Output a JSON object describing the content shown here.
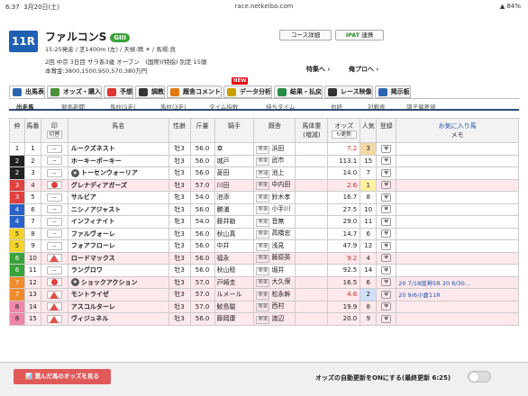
{
  "status_bar": {
    "time": "6:37",
    "date": "3月20日(土)",
    "url": "race.netkeiba.com",
    "battery": "84%"
  },
  "race": {
    "number": "11R",
    "name": "ファルコンS",
    "grade": "GIII",
    "info_line1": "15:25発走 / 芝1400m (左) / 天候:晴 ☀ / 馬場:良",
    "info_line2": "2回 中京 3日目 サラ系3歳 オープン　(国際)(特指) 別定 15頭",
    "info_line3": "本賞金:3800,1500,950,570,380万円"
  },
  "buttons": {
    "course": "コース詳細",
    "ipat_logo": "IPAT",
    "ipat_label": "連携"
  },
  "links": {
    "special": "特集へ ›",
    "my_pro": "俺プロへ ›"
  },
  "tabs": [
    {
      "label": "出馬表",
      "color": "#2a63b0",
      "active": true,
      "new": false
    },
    {
      "label": "オッズ・購入",
      "color": "#4a8f3a",
      "active": false,
      "new": false
    },
    {
      "label": "予想",
      "color": "#d33",
      "active": false,
      "new": false
    },
    {
      "label": "調教",
      "color": "#333",
      "active": false,
      "new": false
    },
    {
      "label": "厩舎コメント",
      "color": "#e07a10",
      "active": false,
      "new": false
    },
    {
      "label": "データ分析",
      "color": "#c8a000",
      "active": false,
      "new": true
    },
    {
      "label": "結果・払戻",
      "color": "#2a8a4a",
      "active": false,
      "new": false
    },
    {
      "label": "レース映像",
      "color": "#333",
      "active": false,
      "new": false
    },
    {
      "label": "掲示板",
      "color": "#2a63b0",
      "active": false,
      "new": false
    }
  ],
  "new_label": "NEW",
  "subtabs": [
    {
      "label": "出走馬",
      "active": true
    },
    {
      "label": "競馬新聞",
      "active": false
    },
    {
      "label": "馬柱(5走)",
      "active": false
    },
    {
      "label": "馬柱(3走)",
      "active": false
    },
    {
      "label": "タイム指数",
      "active": false
    },
    {
      "label": "持ちタイム",
      "active": false
    },
    {
      "label": "血統",
      "active": false
    },
    {
      "label": "対戦表",
      "active": false
    },
    {
      "label": "調子偏差値",
      "active": false
    }
  ],
  "table": {
    "headers": {
      "waku": "枠",
      "umaban": "馬番",
      "mark": "印",
      "mark_sub": "切替",
      "name": "馬名",
      "sex_age": "性齢",
      "weight": "斤量",
      "jockey": "騎手",
      "trainer": "厩舎",
      "body_weight": "馬体重",
      "body_weight_sub": "(増減)",
      "odds": "オッズ",
      "odds_sub": "更新",
      "pop": "人気",
      "reg": "登録",
      "fav": "お気に入り馬",
      "memo": "メモ"
    },
    "rows": [
      {
        "waku": "1",
        "wcolor": "#ffffff",
        "wtext": "#222",
        "num": "1",
        "mark": "--",
        "mclass": "",
        "icon": "",
        "name": "ルークズネスト",
        "sa": "牡3",
        "kin": "56.0",
        "jockey": "幸",
        "tt": "栗東",
        "trainer": "浜田",
        "odds": "7.2",
        "oclass": "red",
        "pop": "3",
        "pbg": "#f5d9a8",
        "hi": false,
        "memo": ""
      },
      {
        "waku": "2",
        "wcolor": "#222222",
        "wtext": "#fff",
        "num": "2",
        "mark": "--",
        "mclass": "",
        "icon": "",
        "name": "ホーキーポーキー",
        "sa": "牡3",
        "kin": "56.0",
        "jockey": "城戸",
        "tt": "栗東",
        "trainer": "武市",
        "odds": "113.1",
        "oclass": "",
        "pop": "15",
        "pbg": "",
        "hi": false,
        "memo": ""
      },
      {
        "waku": "2",
        "wcolor": "#222222",
        "wtext": "#fff",
        "num": "3",
        "mark": "--",
        "mclass": "",
        "icon": "circle-dark",
        "name": "トーセンウォーリア",
        "sa": "牡3",
        "kin": "56.0",
        "jockey": "菱田",
        "tt": "美浦",
        "trainer": "池上",
        "odds": "14.0",
        "oclass": "",
        "pop": "7",
        "pbg": "",
        "hi": false,
        "memo": ""
      },
      {
        "waku": "3",
        "wcolor": "#e04040",
        "wtext": "#fff",
        "num": "4",
        "mark": "",
        "mclass": "red",
        "icon": "",
        "name": "グレナディアガーズ",
        "sa": "牡3",
        "kin": "57.0",
        "jockey": "川田",
        "tt": "栗東",
        "trainer": "中内田",
        "odds": "2.6",
        "oclass": "red",
        "pop": "1",
        "pbg": "#fff1a0",
        "hi": true,
        "memo": ""
      },
      {
        "waku": "3",
        "wcolor": "#e04040",
        "wtext": "#fff",
        "num": "5",
        "mark": "--",
        "mclass": "",
        "icon": "",
        "name": "サルビア",
        "sa": "牝3",
        "kin": "54.0",
        "jockey": "池添",
        "tt": "栗東",
        "trainer": "鈴木孝",
        "odds": "16.7",
        "oclass": "",
        "pop": "8",
        "pbg": "",
        "hi": false,
        "memo": ""
      },
      {
        "waku": "4",
        "wcolor": "#2a63c8",
        "wtext": "#fff",
        "num": "6",
        "mark": "--",
        "mclass": "",
        "icon": "",
        "name": "ニシノアジャスト",
        "sa": "牡3",
        "kin": "56.0",
        "jockey": "勝浦",
        "tt": "栗東",
        "trainer": "小手川",
        "odds": "27.5",
        "oclass": "",
        "pop": "10",
        "pbg": "",
        "hi": false,
        "memo": ""
      },
      {
        "waku": "4",
        "wcolor": "#2a63c8",
        "wtext": "#fff",
        "num": "7",
        "mark": "--",
        "mclass": "",
        "icon": "",
        "name": "インフィナイト",
        "sa": "牝3",
        "kin": "54.0",
        "jockey": "藤井勘",
        "tt": "栗東",
        "trainer": "音無",
        "odds": "29.0",
        "oclass": "",
        "pop": "11",
        "pbg": "",
        "hi": false,
        "memo": ""
      },
      {
        "waku": "5",
        "wcolor": "#f2d22c",
        "wtext": "#222",
        "num": "8",
        "mark": "--",
        "mclass": "",
        "icon": "",
        "name": "ファルヴォーレ",
        "sa": "牡3",
        "kin": "56.0",
        "jockey": "秋山真",
        "tt": "栗東",
        "trainer": "高橋忠",
        "odds": "14.7",
        "oclass": "",
        "pop": "6",
        "pbg": "",
        "hi": false,
        "memo": ""
      },
      {
        "waku": "5",
        "wcolor": "#f2d22c",
        "wtext": "#222",
        "num": "9",
        "mark": "--",
        "mclass": "",
        "icon": "",
        "name": "フォアフローレ",
        "sa": "牡3",
        "kin": "56.0",
        "jockey": "中井",
        "tt": "栗東",
        "trainer": "浅見",
        "odds": "47.9",
        "oclass": "",
        "pop": "12",
        "pbg": "",
        "hi": false,
        "memo": ""
      },
      {
        "waku": "6",
        "wcolor": "#3aa33a",
        "wtext": "#fff",
        "num": "10",
        "mark": "tri",
        "mclass": "",
        "icon": "",
        "name": "ロードマックス",
        "sa": "牡3",
        "kin": "56.0",
        "jockey": "福永",
        "tt": "栗東",
        "trainer": "藤原英",
        "odds": "9.2",
        "oclass": "red",
        "pop": "4",
        "pbg": "",
        "hi": true,
        "memo": ""
      },
      {
        "waku": "6",
        "wcolor": "#3aa33a",
        "wtext": "#fff",
        "num": "11",
        "mark": "--",
        "mclass": "",
        "icon": "",
        "name": "ラングロワ",
        "sa": "牡3",
        "kin": "56.0",
        "jockey": "秋山稔",
        "tt": "栗東",
        "trainer": "堀井",
        "odds": "92.5",
        "oclass": "",
        "pop": "14",
        "pbg": "",
        "hi": false,
        "memo": ""
      },
      {
        "waku": "7",
        "wcolor": "#f08a2a",
        "wtext": "#fff",
        "num": "12",
        "mark": "",
        "mclass": "red",
        "icon": "circle-dark",
        "name": "ショックアクション",
        "sa": "牡3",
        "kin": "57.0",
        "jockey": "戸崎圭",
        "tt": "栗東",
        "trainer": "大久保",
        "odds": "16.5",
        "oclass": "",
        "pop": "6",
        "pbg": "",
        "hi": true,
        "memo": "20 7/18阪神5R 20 8/30…"
      },
      {
        "waku": "7",
        "wcolor": "#f08a2a",
        "wtext": "#fff",
        "num": "13",
        "mark": "tri",
        "mclass": "",
        "icon": "",
        "name": "モントライゼ",
        "sa": "牡3",
        "kin": "57.0",
        "jockey": "ルメール",
        "tt": "栗東",
        "trainer": "松永幹",
        "odds": "4.6",
        "oclass": "red",
        "pop": "2",
        "pbg": "#cfe0f8",
        "hi": true,
        "memo": "20 9/6小倉11R"
      },
      {
        "waku": "8",
        "wcolor": "#ef86a8",
        "wtext": "#222",
        "num": "14",
        "mark": "tri",
        "mclass": "",
        "icon": "",
        "name": "アスコルターレ",
        "sa": "牡3",
        "kin": "57.0",
        "jockey": "鮫島駿",
        "tt": "栗東",
        "trainer": "西村",
        "odds": "19.9",
        "oclass": "",
        "pop": "8",
        "pbg": "",
        "hi": true,
        "memo": ""
      },
      {
        "waku": "8",
        "wcolor": "#ef86a8",
        "wtext": "#222",
        "num": "15",
        "mark": "tri",
        "mclass": "",
        "icon": "",
        "name": "ヴィジュネル",
        "sa": "牡3",
        "kin": "56.0",
        "jockey": "藤岡康",
        "tt": "栗東",
        "trainer": "渡辺",
        "odds": "20.0",
        "oclass": "",
        "pop": "9",
        "pbg": "",
        "hi": true,
        "memo": ""
      }
    ]
  },
  "bottom": {
    "odds_button": "選んだ馬のオッズを見る",
    "auto_update": "オッズの自動更新をONにする(最終更新 6:25)"
  }
}
